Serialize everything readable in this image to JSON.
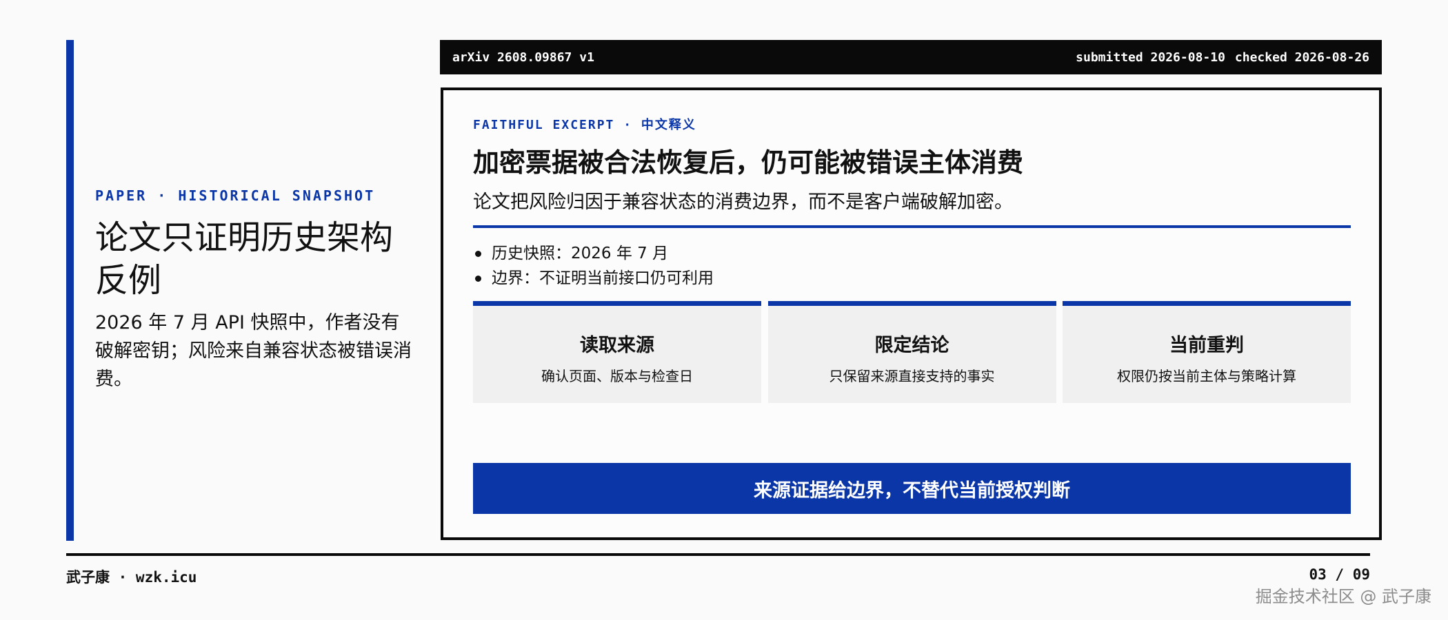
{
  "left": {
    "kicker": "PAPER · HISTORICAL SNAPSHOT",
    "title": "论文只证明历史架构反例",
    "body": "2026 年 7 月 API 快照中，作者没有破解密钥；风险来自兼容状态被错误消费。"
  },
  "header": {
    "doc_id": "arXiv 2608.09867 v1",
    "submitted": "submitted 2026-08-10",
    "checked": "checked 2026-08-26"
  },
  "excerpt": {
    "kicker": "FAITHFUL EXCERPT · 中文释义",
    "title": "加密票据被合法恢复后，仍可能被错误主体消费",
    "subtitle": "论文把风险归因于兼容状态的消费边界，而不是客户端破解加密。",
    "bullets": [
      "历史快照：2026 年 7 月",
      "边界：不证明当前接口仍可利用"
    ],
    "steps": [
      {
        "title": "读取来源",
        "desc": "确认页面、版本与检查日"
      },
      {
        "title": "限定结论",
        "desc": "只保留来源直接支持的事实"
      },
      {
        "title": "当前重判",
        "desc": "权限仍按当前主体与策略计算"
      }
    ],
    "cta": "来源证据给边界，不替代当前授权判断"
  },
  "footer": {
    "author": "武子康 · wzk.icu",
    "page": "03 / 09",
    "watermark": "掘金技术社区 @ 武子康"
  },
  "colors": {
    "accent": "#0b36a8",
    "ink": "#0a0a0a",
    "background": "#fafafa",
    "panel": "#f0f0f0"
  }
}
